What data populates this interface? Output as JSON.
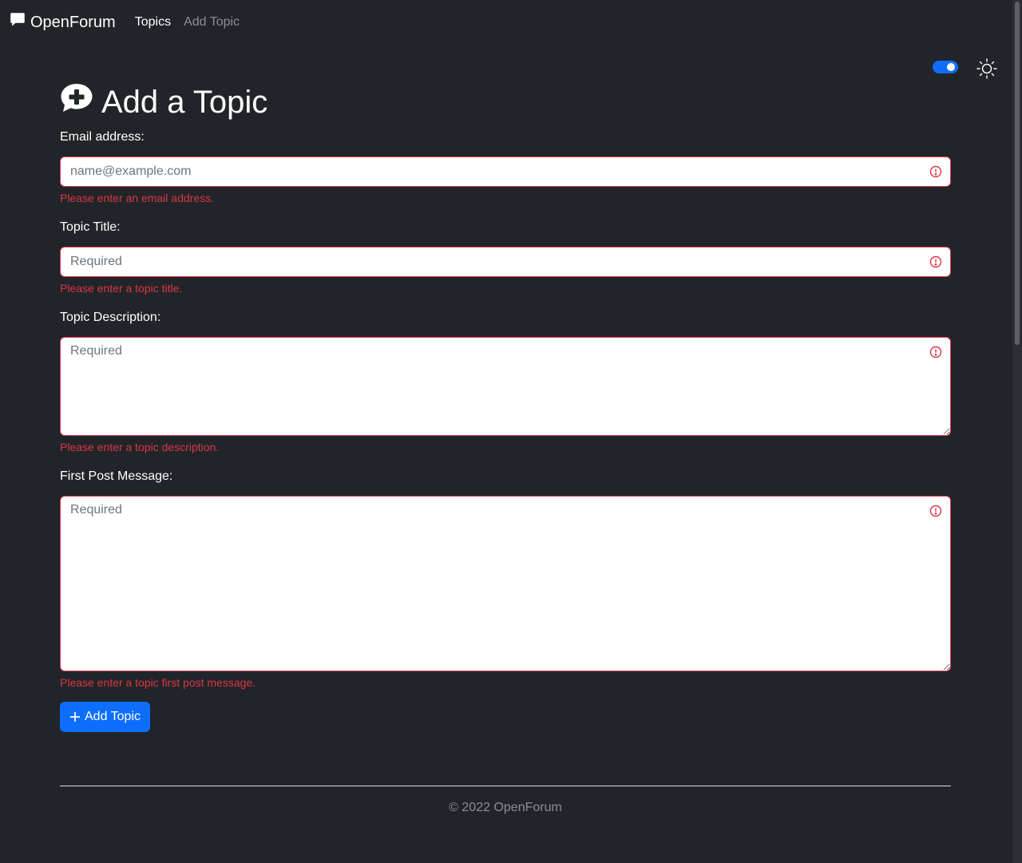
{
  "nav": {
    "brand": "OpenForum",
    "links": [
      {
        "label": "Topics",
        "active": true
      },
      {
        "label": "Add Topic",
        "active": false
      }
    ]
  },
  "theme": {
    "toggle_on": true,
    "icon": "sun-icon",
    "accent": "#0d6efd"
  },
  "page": {
    "title": "Add a Topic",
    "title_icon": "chat-plus-icon"
  },
  "form": {
    "email": {
      "label": "Email address:",
      "placeholder": "name@example.com",
      "value": "",
      "error": "Please enter an email address."
    },
    "title": {
      "label": "Topic Title:",
      "placeholder": "Required",
      "value": "",
      "error": "Please enter a topic title."
    },
    "description": {
      "label": "Topic Description:",
      "placeholder": "Required",
      "value": "",
      "error": "Please enter a topic description."
    },
    "first_post": {
      "label": "First Post Message:",
      "placeholder": "Required",
      "value": "",
      "error": "Please enter a topic first post message."
    },
    "submit_label": "Add Topic",
    "error_color": "#dc3545"
  },
  "footer": {
    "text": "© 2022 OpenForum"
  }
}
